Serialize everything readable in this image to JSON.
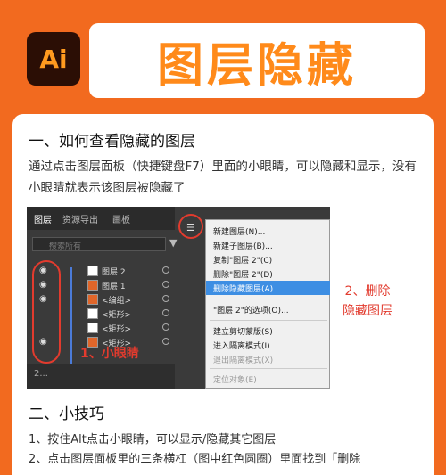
{
  "header": {
    "logo": "Ai",
    "title": "图层隐藏"
  },
  "section1": {
    "heading": "一、如何查看隐藏的图层",
    "paragraph": "通过点击图层面板（快捷键盘F7）里面的小眼睛，可以隐藏和显示，没有小眼睛就表示该图层被隐藏了"
  },
  "screenshot": {
    "tabs": [
      "图层",
      "资源导出",
      "画板"
    ],
    "search_placeholder": "搜索所有",
    "layers": [
      {
        "name": "图层 2",
        "eye": true,
        "indent": 0
      },
      {
        "name": "图层 1",
        "eye": true,
        "indent": 0
      },
      {
        "name": "<编组>",
        "eye": true,
        "indent": 1
      },
      {
        "name": "<矩形>",
        "eye": false,
        "indent": 1
      },
      {
        "name": "<矩形>",
        "eye": false,
        "indent": 1
      },
      {
        "name": "<矩形>",
        "eye": true,
        "indent": 1
      }
    ],
    "annotation_eye": "1、小眼睛",
    "bottom_label": "2...",
    "context_menu": [
      {
        "label": "新建图层(N)...",
        "disabled": false
      },
      {
        "label": "新建子图层(B)...",
        "disabled": false
      },
      {
        "label": "复制\"图层 2\"(C)",
        "disabled": false
      },
      {
        "label": "删除\"图层 2\"(D)",
        "disabled": false
      },
      {
        "label": "删除隐藏图层(A)",
        "disabled": false,
        "highlight": true
      },
      {
        "label": "\"图层 2\"的选项(O)...",
        "disabled": false
      },
      {
        "label": "建立剪切蒙版(S)",
        "disabled": false
      },
      {
        "label": "进入隔离模式(I)",
        "disabled": false
      },
      {
        "label": "退出隔离模式(X)",
        "disabled": true
      },
      {
        "label": "定位对象(E)",
        "disabled": true
      }
    ]
  },
  "annotation_delete": {
    "line1": "2、删除",
    "line2": "隐藏图层"
  },
  "section2": {
    "heading": "二、小技巧",
    "tip1": "1、按住Alt点击小眼睛，可以显示/隐藏其它图层",
    "tip2": "2、点击图层面板里的三条横杠（图中红色圆圈）里面找到「删除"
  },
  "colors": {
    "background": "#f26a1f",
    "accent": "#ff8a1a",
    "annotation": "#e23b2e",
    "highlight": "#3d8ee3"
  }
}
